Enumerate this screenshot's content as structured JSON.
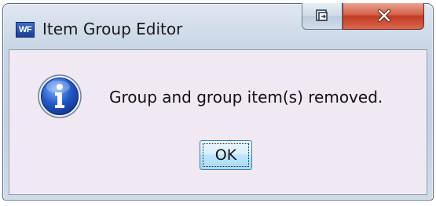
{
  "window": {
    "title": "Item Group Editor",
    "app_icon_text": "WF"
  },
  "title_buttons": {
    "restore_icon": "restore-window-icon",
    "close_icon": "close-icon"
  },
  "dialog": {
    "icon": "info-icon",
    "message": "Group and group item(s) removed.",
    "ok_label": "OK"
  },
  "colors": {
    "close_button": "#c7452d",
    "info_icon": "#1f57c5",
    "ok_button_border": "#3c7fb1",
    "client_background": "#f0e8f3"
  }
}
